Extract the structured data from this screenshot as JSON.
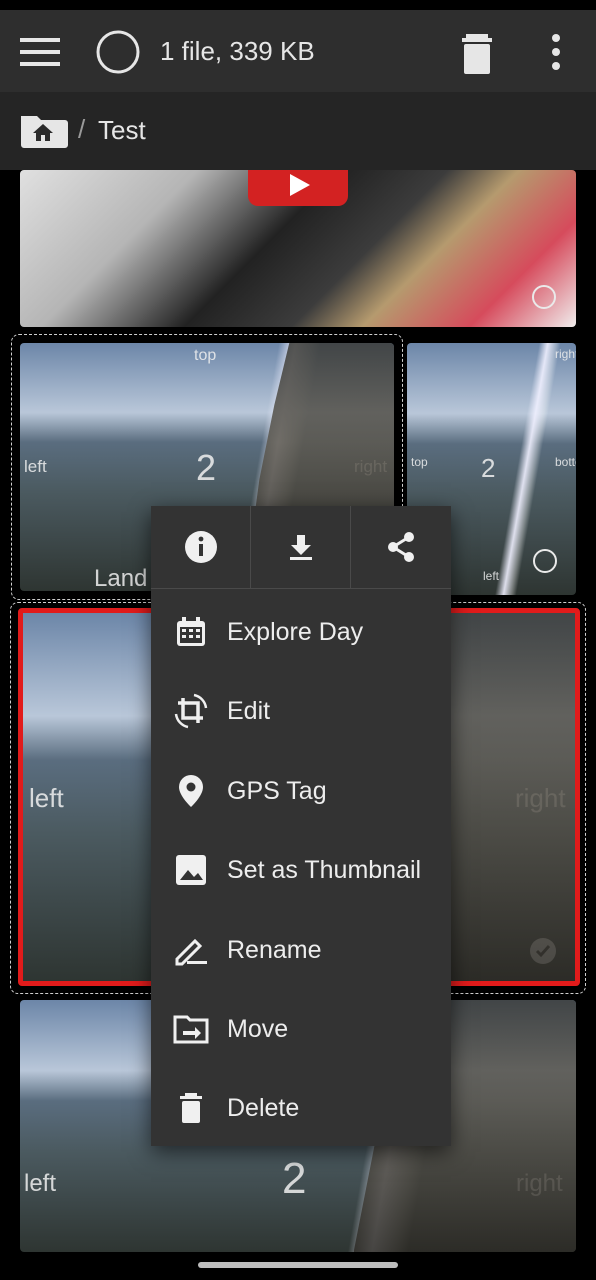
{
  "app_bar": {
    "selection_text": "1 file, 339 KB"
  },
  "breadcrumb": {
    "separator": "/",
    "current": "Test"
  },
  "tiles": {
    "landscape": {
      "top": "top",
      "left": "left",
      "right": "right",
      "number": "2",
      "caption": "Land"
    },
    "portrait": {
      "top": "right",
      "left": "top",
      "right": "bottom",
      "bottom": "left",
      "number": "2"
    },
    "selected": {
      "left": "left",
      "right": "right"
    },
    "last": {
      "left": "left",
      "right": "right",
      "number": "2"
    }
  },
  "context_menu": {
    "quick_actions": [
      {
        "icon": "info-icon"
      },
      {
        "icon": "download-icon"
      },
      {
        "icon": "share-icon"
      }
    ],
    "items": [
      {
        "label": "Explore Day",
        "icon": "calendar-icon"
      },
      {
        "label": "Edit",
        "icon": "crop-rotate-icon"
      },
      {
        "label": "GPS Tag",
        "icon": "location-pin-icon"
      },
      {
        "label": "Set as Thumbnail",
        "icon": "image-icon"
      },
      {
        "label": "Rename",
        "icon": "pencil-icon"
      },
      {
        "label": "Move",
        "icon": "move-to-folder-icon"
      },
      {
        "label": "Delete",
        "icon": "delete-icon"
      }
    ]
  },
  "colors": {
    "app_bar": "#2e2e2e",
    "breadcrumb_bar": "#252525",
    "menu_bg": "#333333",
    "selection_border": "#e11b1b",
    "play_button": "#d32222"
  }
}
